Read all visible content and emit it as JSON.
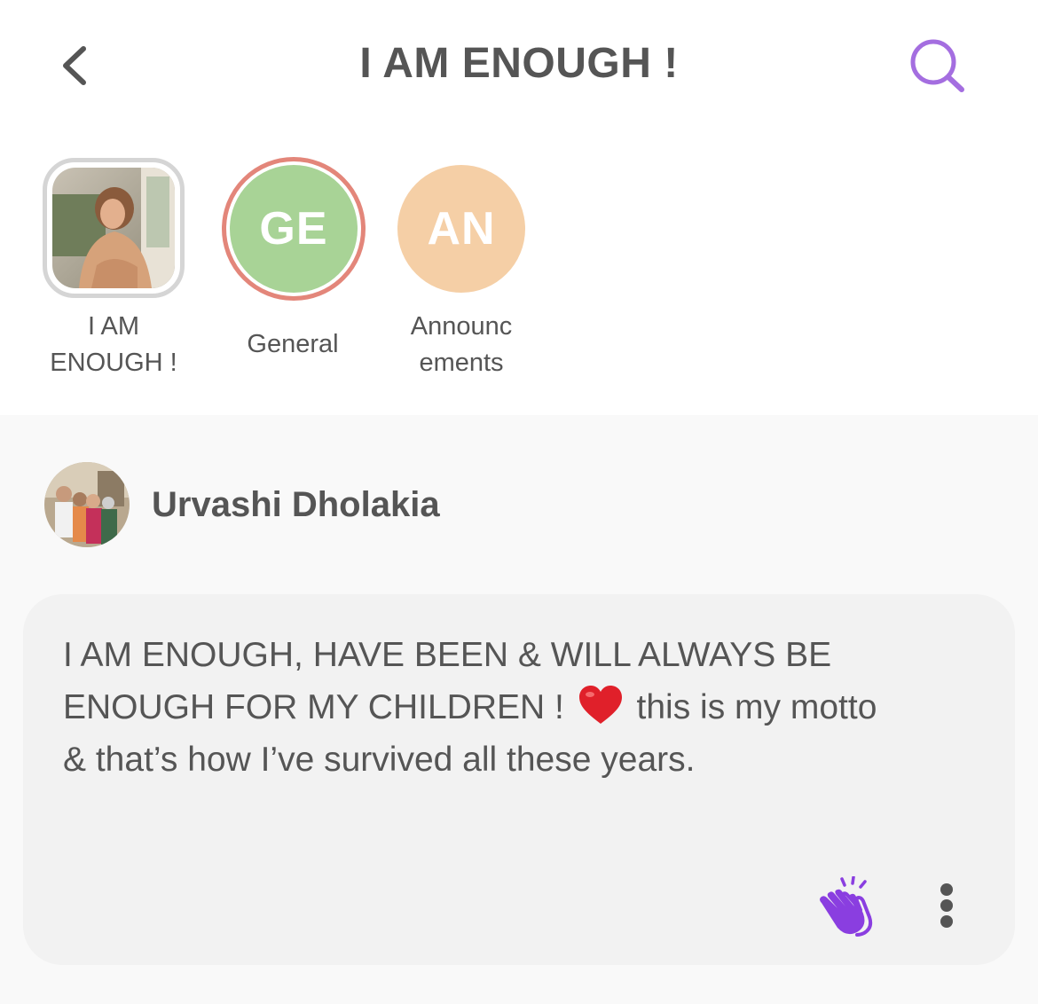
{
  "header": {
    "title": "I AM ENOUGH !",
    "back_icon": "chevron-left-icon",
    "search_icon": "search-icon",
    "search_color": "#a46ee0"
  },
  "channels": [
    {
      "label_line1": "I AM",
      "label_line2": "ENOUGH !",
      "type": "photo"
    },
    {
      "initials": "GE",
      "label": "General",
      "color": "#a8d396",
      "ring_color": "#e3867a"
    },
    {
      "initials": "AN",
      "label_line1": "Announc",
      "label_line2": "ements",
      "color": "#f5cfa6"
    }
  ],
  "post": {
    "author": "Urvashi Dholakia",
    "text_part1": "I AM ENOUGH, HAVE BEEN & WILL ALWAYS BE ENOUGH FOR MY CHILDREN ! ",
    "emoji": "❤️",
    "text_part2": " this is my motto & that’s how I’ve survived all these years.",
    "clap_icon": "clap-hands-icon",
    "clap_color": "#8a3ee0",
    "more_icon": "more-vertical-icon"
  }
}
